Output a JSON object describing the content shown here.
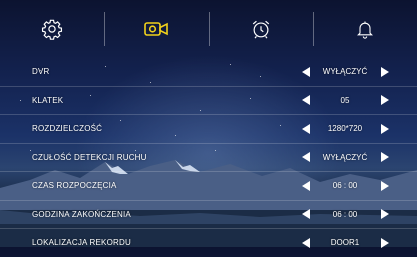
{
  "tabs": [
    {
      "icon": "gear-icon",
      "active": false
    },
    {
      "icon": "video-camera-icon",
      "active": true
    },
    {
      "icon": "alarm-clock-icon",
      "active": false
    },
    {
      "icon": "bell-icon",
      "active": false
    }
  ],
  "colors": {
    "accent": "#f2d21b",
    "text": "#ffffff"
  },
  "settings": [
    {
      "label": "DVR",
      "value": "WYŁĄCZYĆ"
    },
    {
      "label": "KLATEK",
      "value": "05"
    },
    {
      "label": "ROZDZIELCZOŚĆ",
      "value": "1280*720"
    },
    {
      "label": "CZUŁOŚĆ DETEKCJI RUCHU",
      "value": "WYŁĄCZYĆ"
    },
    {
      "label": "CZAS ROZPOCZĘCIA",
      "value": "06 : 00"
    },
    {
      "label": "GODZINA ZAKOŃCZENIA",
      "value": "06 : 00"
    },
    {
      "label": "LOKALIZACJA REKORDU",
      "value": "DOOR1"
    }
  ]
}
